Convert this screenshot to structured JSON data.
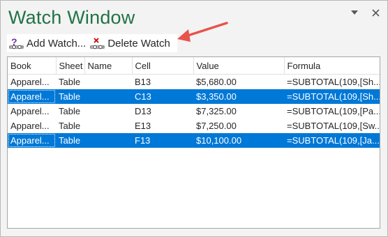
{
  "window": {
    "title": "Watch Window"
  },
  "toolbar": {
    "add_watch_label": "Add Watch...",
    "delete_watch_label": "Delete Watch"
  },
  "colors": {
    "title": "#217346",
    "selection": "#0078d7",
    "arrow": "#e8534a"
  },
  "icons": {
    "add": "add-watch-icon",
    "delete": "delete-watch-icon",
    "dropdown": "chevron-down-icon",
    "close": "close-icon"
  },
  "table": {
    "columns": [
      "Book",
      "Sheet",
      "Name",
      "Cell",
      "Value",
      "Formula"
    ],
    "rows": [
      {
        "book": "Apparel...",
        "sheet": "Table",
        "name": "",
        "cell": "B13",
        "value": "$5,680.00",
        "formula": "=SUBTOTAL(109,[Sh...",
        "selected": false
      },
      {
        "book": "Apparel...",
        "sheet": "Table",
        "name": "",
        "cell": "C13",
        "value": "$3,350.00",
        "formula": "=SUBTOTAL(109,[Sh...",
        "selected": true
      },
      {
        "book": "Apparel...",
        "sheet": "Table",
        "name": "",
        "cell": "D13",
        "value": "$7,325.00",
        "formula": "=SUBTOTAL(109,[Pa...",
        "selected": false
      },
      {
        "book": "Apparel...",
        "sheet": "Table",
        "name": "",
        "cell": "E13",
        "value": "$7,250.00",
        "formula": "=SUBTOTAL(109,[Sw...",
        "selected": false
      },
      {
        "book": "Apparel...",
        "sheet": "Table",
        "name": "",
        "cell": "F13",
        "value": "$10,100.00",
        "formula": "=SUBTOTAL(109,[Ja...",
        "selected": true
      }
    ]
  }
}
